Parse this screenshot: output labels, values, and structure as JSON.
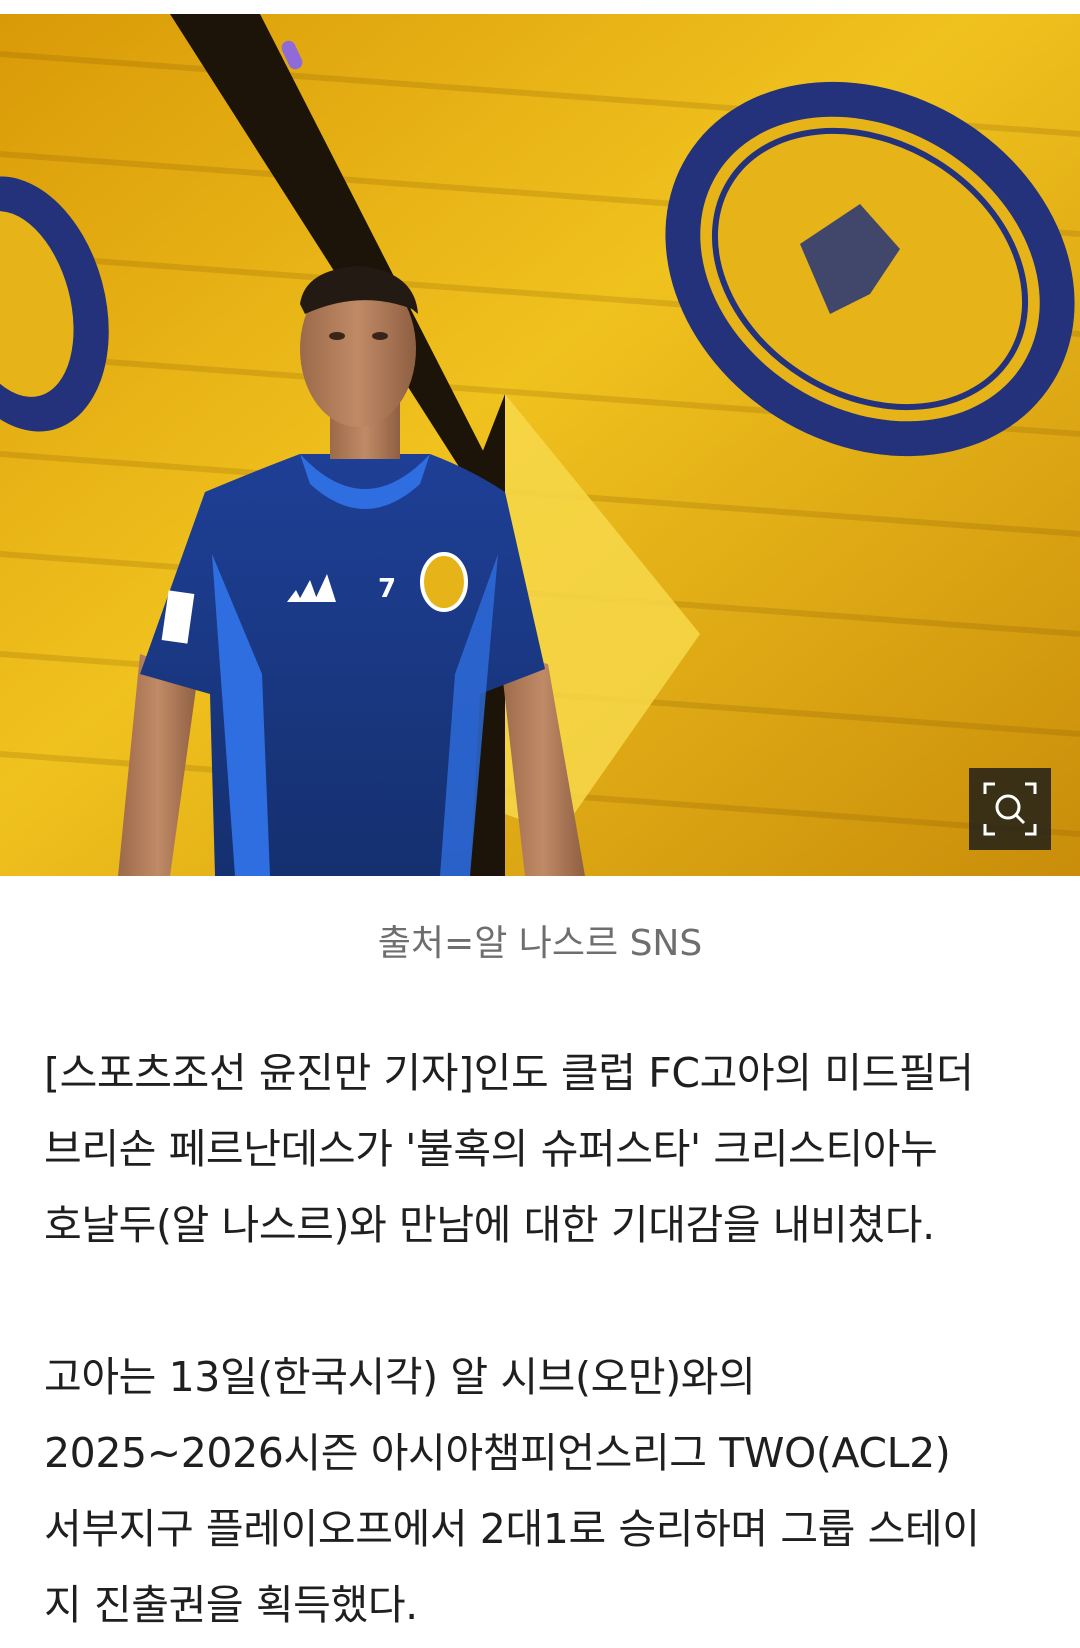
{
  "photo": {
    "caption": "출처=알 나스르 SNS",
    "zoom_icon": "zoom-search-icon",
    "jersey_number": "7",
    "colors": {
      "wall_yellow": "#e3ad12",
      "kit_blue": "#1c3a8a",
      "accent_blue": "#2f6ee0",
      "badge_navy": "#23327a"
    }
  },
  "article": {
    "paragraphs": [
      {
        "lines": [
          "[스포츠조선 윤진만 기자]인도 클럽 FC고아의 미드필더",
          "브리손 페르난데스가 '불혹의 슈퍼스타' 크리스티아누",
          "호날두(알 나스르)와 만남에 대한 기대감을 내비쳤다."
        ]
      },
      {
        "lines": [
          "고아는 13일(한국시각) 알 시브(오만)와의",
          "2025~2026시즌 아시아챔피언스리그 TWO(ACL2)",
          "서부지구 플레이오프에서 2대1로 승리하며 그룹 스테이",
          "지 진출권을 획득했다."
        ]
      }
    ]
  }
}
